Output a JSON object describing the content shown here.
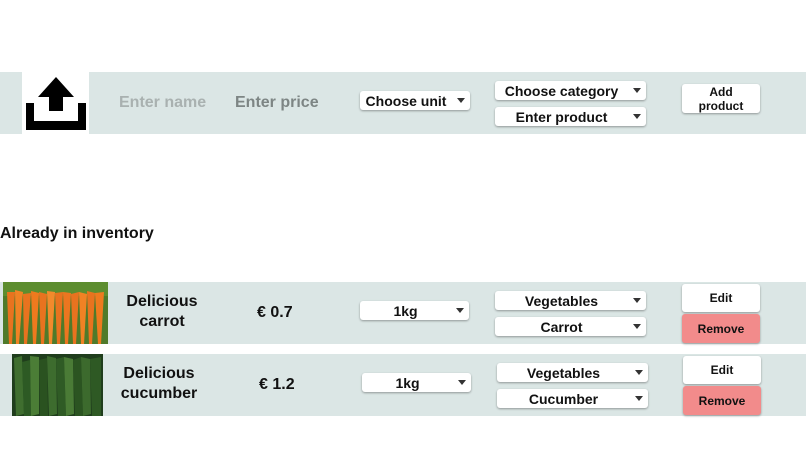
{
  "add_form": {
    "upload_icon": "upload-icon",
    "name_placeholder": "Enter name",
    "price_placeholder": "Enter price",
    "unit_select": "Choose unit",
    "category_select": "Choose category",
    "product_select": "Enter product",
    "add_button": "Add product"
  },
  "inventory": {
    "heading": "Already in inventory",
    "items": [
      {
        "name": "Delicious carrot",
        "price": "€ 0.7",
        "unit": "1kg",
        "category": "Vegetables",
        "product": "Carrot",
        "edit": "Edit",
        "remove": "Remove"
      },
      {
        "name": "Delicious cucumber",
        "price": "€ 1.2",
        "unit": "1kg",
        "category": "Vegetables",
        "product": "Cucumber",
        "edit": "Edit",
        "remove": "Remove"
      }
    ]
  },
  "colors": {
    "band": "#dbe6e5",
    "remove_button": "#f28b8b"
  }
}
